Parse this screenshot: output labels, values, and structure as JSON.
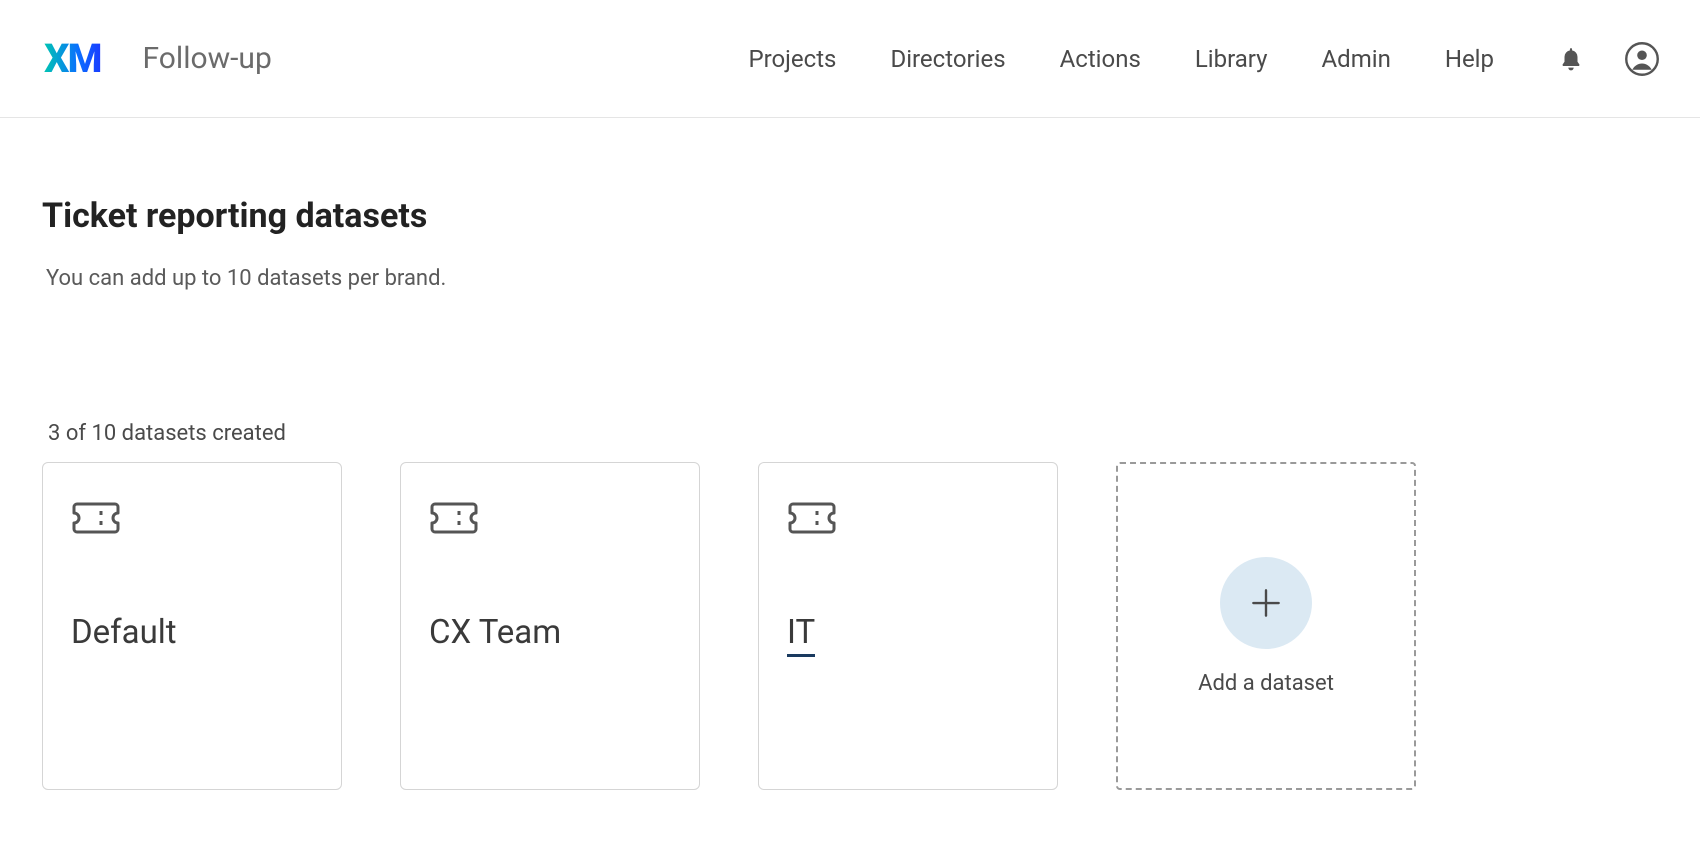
{
  "header": {
    "logo_text": "XM",
    "brand_label": "Follow-up",
    "nav": {
      "projects": "Projects",
      "directories": "Directories",
      "actions": "Actions",
      "library": "Library",
      "admin": "Admin",
      "help": "Help"
    }
  },
  "page": {
    "title": "Ticket reporting datasets",
    "subtext": "You can add up to 10 datasets per brand.",
    "count_text": "3 of 10 datasets created"
  },
  "datasets": [
    {
      "name": "Default"
    },
    {
      "name": "CX Team"
    },
    {
      "name": "IT"
    }
  ],
  "add_card": {
    "label": "Add a dataset"
  }
}
